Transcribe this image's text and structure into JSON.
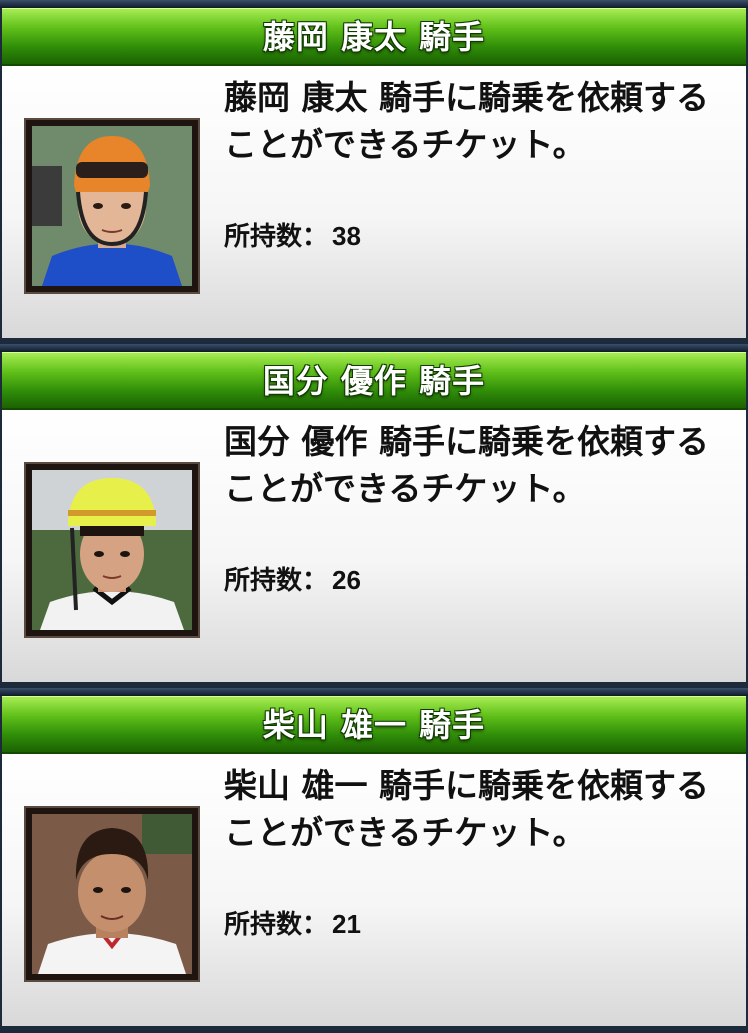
{
  "tickets": [
    {
      "title": "藤岡 康太 騎手",
      "description": "藤岡 康太 騎手に騎乗を依頼することができるチケット。",
      "count_label": "所持数：",
      "count": "38",
      "photo": "jockey-portrait-orange-helmet",
      "helmet_color": "#e8842a",
      "shirt_color": "#1f4fc8",
      "bg_color": "#6f8b6b"
    },
    {
      "title": "国分 優作 騎手",
      "description": "国分 優作 騎手に騎乗を依頼することができるチケット。",
      "count_label": "所持数：",
      "count": "26",
      "photo": "jockey-portrait-yellow-helmet",
      "helmet_color": "#e7f04a",
      "shirt_color": "#f2f2f2",
      "bg_color": "#4d6a3f"
    },
    {
      "title": "柴山 雄一 騎手",
      "description": "柴山 雄一 騎手に騎乗を依頼することができるチケット。",
      "count_label": "所持数：",
      "count": "21",
      "photo": "jockey-portrait-bareheaded",
      "helmet_color": "#2a1a12",
      "shirt_color": "#f4f4f4",
      "bg_color": "#7c5a48"
    }
  ]
}
